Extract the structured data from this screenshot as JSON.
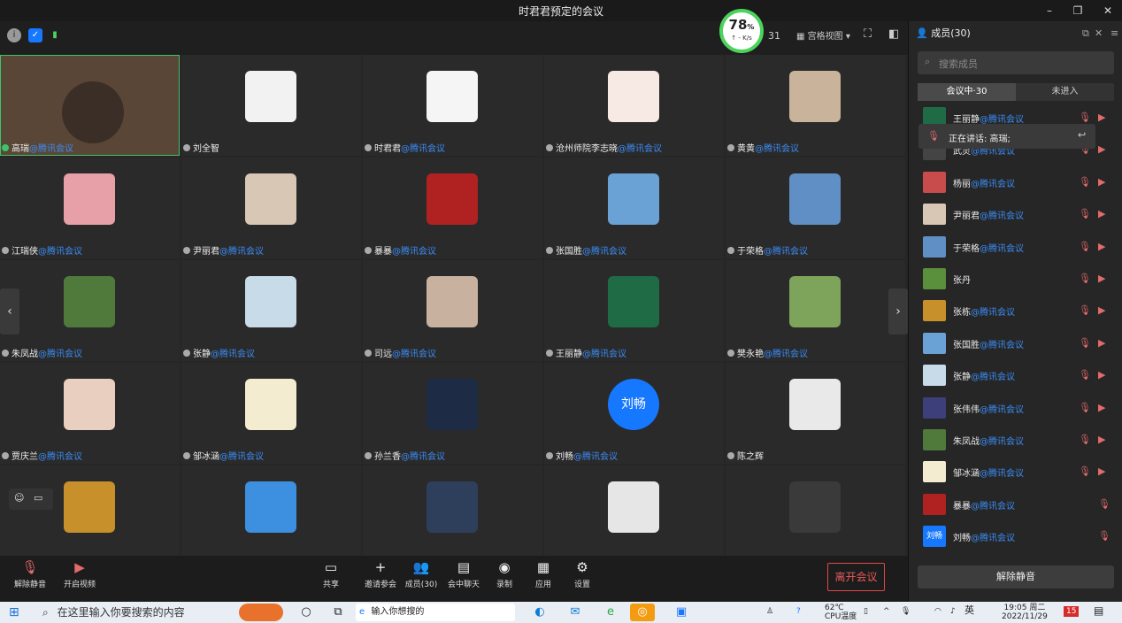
{
  "window": {
    "title": "时君君预定的会议",
    "min": "–",
    "max": "❐",
    "close": "✕"
  },
  "topbar": {
    "net_pct": "78",
    "net_pct_unit": "%",
    "net_speed": "↑ - K/s",
    "count": "31",
    "view_label": "宫格视图",
    "view_chevron": "▾"
  },
  "tag": "@腾讯会议",
  "tiles": [
    {
      "name": "高瑞",
      "tag": true,
      "color": "#6a4e38",
      "active": true
    },
    {
      "name": "刘全智",
      "tag": false,
      "color": "#f2f2f2"
    },
    {
      "name": "时君君",
      "tag": true,
      "color": "#f5f5f5"
    },
    {
      "name": "沧州师院李志晓",
      "tag": true,
      "color": "#f7e9e4"
    },
    {
      "name": "黄黄",
      "tag": true,
      "color": "#c9b39b"
    },
    {
      "name": "江瑞侠",
      "tag": true,
      "color": "#e8a0a8"
    },
    {
      "name": "尹丽君",
      "tag": true,
      "color": "#d9c7b5"
    },
    {
      "name": "暴暴",
      "tag": true,
      "color": "#b02222"
    },
    {
      "name": "张国胜",
      "tag": true,
      "color": "#6ba2d6"
    },
    {
      "name": "于荣格",
      "tag": true,
      "color": "#5f8fc4"
    },
    {
      "name": "朱凤战",
      "tag": true,
      "color": "#4f7a3c"
    },
    {
      "name": "张静",
      "tag": true,
      "color": "#c7dbe9"
    },
    {
      "name": "司远",
      "tag": true,
      "color": "#c9b1a0"
    },
    {
      "name": "王丽静",
      "tag": true,
      "color": "#1f6b45"
    },
    {
      "name": "樊永艳",
      "tag": true,
      "color": "#7ea35a"
    },
    {
      "name": "贾庆兰",
      "tag": true,
      "color": "#e8cfc0"
    },
    {
      "name": "邹冰涵",
      "tag": true,
      "color": "#f3ecd0"
    },
    {
      "name": "孙兰香",
      "tag": true,
      "color": "#1d2c44"
    },
    {
      "name": "刘畅",
      "tag": true,
      "color": "#1677ff",
      "initials": "刘畅",
      "round": true
    },
    {
      "name": "陈之辉",
      "tag": false,
      "color": "#e9e9e9"
    },
    {
      "name": "",
      "tag": false,
      "color": "#c7902b"
    },
    {
      "name": "",
      "tag": false,
      "color": "#3d8fe0"
    },
    {
      "name": "",
      "tag": false,
      "color": "#2e3f5c"
    },
    {
      "name": "",
      "tag": false,
      "color": "#e6e6e6"
    },
    {
      "name": "",
      "tag": false,
      "color": "#3a3a3a"
    }
  ],
  "toolbar": {
    "unmute": "解除静音",
    "start_video": "开启视频",
    "share": "共享",
    "invite": "邀请参会",
    "members": "成员(30)",
    "chat": "会中聊天",
    "record": "录制",
    "apps": "应用",
    "settings": "设置",
    "leave": "离开会议"
  },
  "panel": {
    "title": "成员(30)",
    "search_placeholder": "搜索成员",
    "tab_in": "会议中·30",
    "tab_out": "未进入",
    "speaking": "正在讲话: 高瑞;",
    "unmute_all": "解除静音",
    "members": [
      {
        "name": "王丽静",
        "tag": true,
        "color": "#1f6b45",
        "cam": true
      },
      {
        "name": "武灵",
        "tag": true,
        "color": "#444444",
        "cam": true
      },
      {
        "name": "杨丽",
        "tag": true,
        "color": "#c94c4c",
        "cam": true
      },
      {
        "name": "尹丽君",
        "tag": true,
        "color": "#d9c7b5",
        "cam": true
      },
      {
        "name": "于荣格",
        "tag": true,
        "color": "#5f8fc4",
        "cam": true
      },
      {
        "name": "张丹",
        "tag": false,
        "color": "#5a8f3c",
        "cam": true
      },
      {
        "name": "张栋",
        "tag": true,
        "color": "#c7902b",
        "cam": true
      },
      {
        "name": "张国胜",
        "tag": true,
        "color": "#6ba2d6",
        "cam": true
      },
      {
        "name": "张静",
        "tag": true,
        "color": "#c7dbe9",
        "cam": true
      },
      {
        "name": "张伟伟",
        "tag": true,
        "color": "#3c3f7a",
        "cam": true
      },
      {
        "name": "朱凤战",
        "tag": true,
        "color": "#4f7a3c",
        "cam": true
      },
      {
        "name": "邹冰涵",
        "tag": true,
        "color": "#f3ecd0",
        "cam": true
      },
      {
        "name": "暴暴",
        "tag": true,
        "color": "#b02222",
        "cam": false
      },
      {
        "name": "刘畅",
        "tag": true,
        "color": "#1677ff",
        "cam": false,
        "initials": "刘畅"
      }
    ]
  },
  "taskbar": {
    "search": "在这里输入你要搜索的内容",
    "browser_input": "输入你想搜的",
    "temp": "62℃",
    "cpu": "CPU温度",
    "ime": "英",
    "time": "19:05 周二",
    "date": "2022/11/29",
    "badge": "15"
  }
}
